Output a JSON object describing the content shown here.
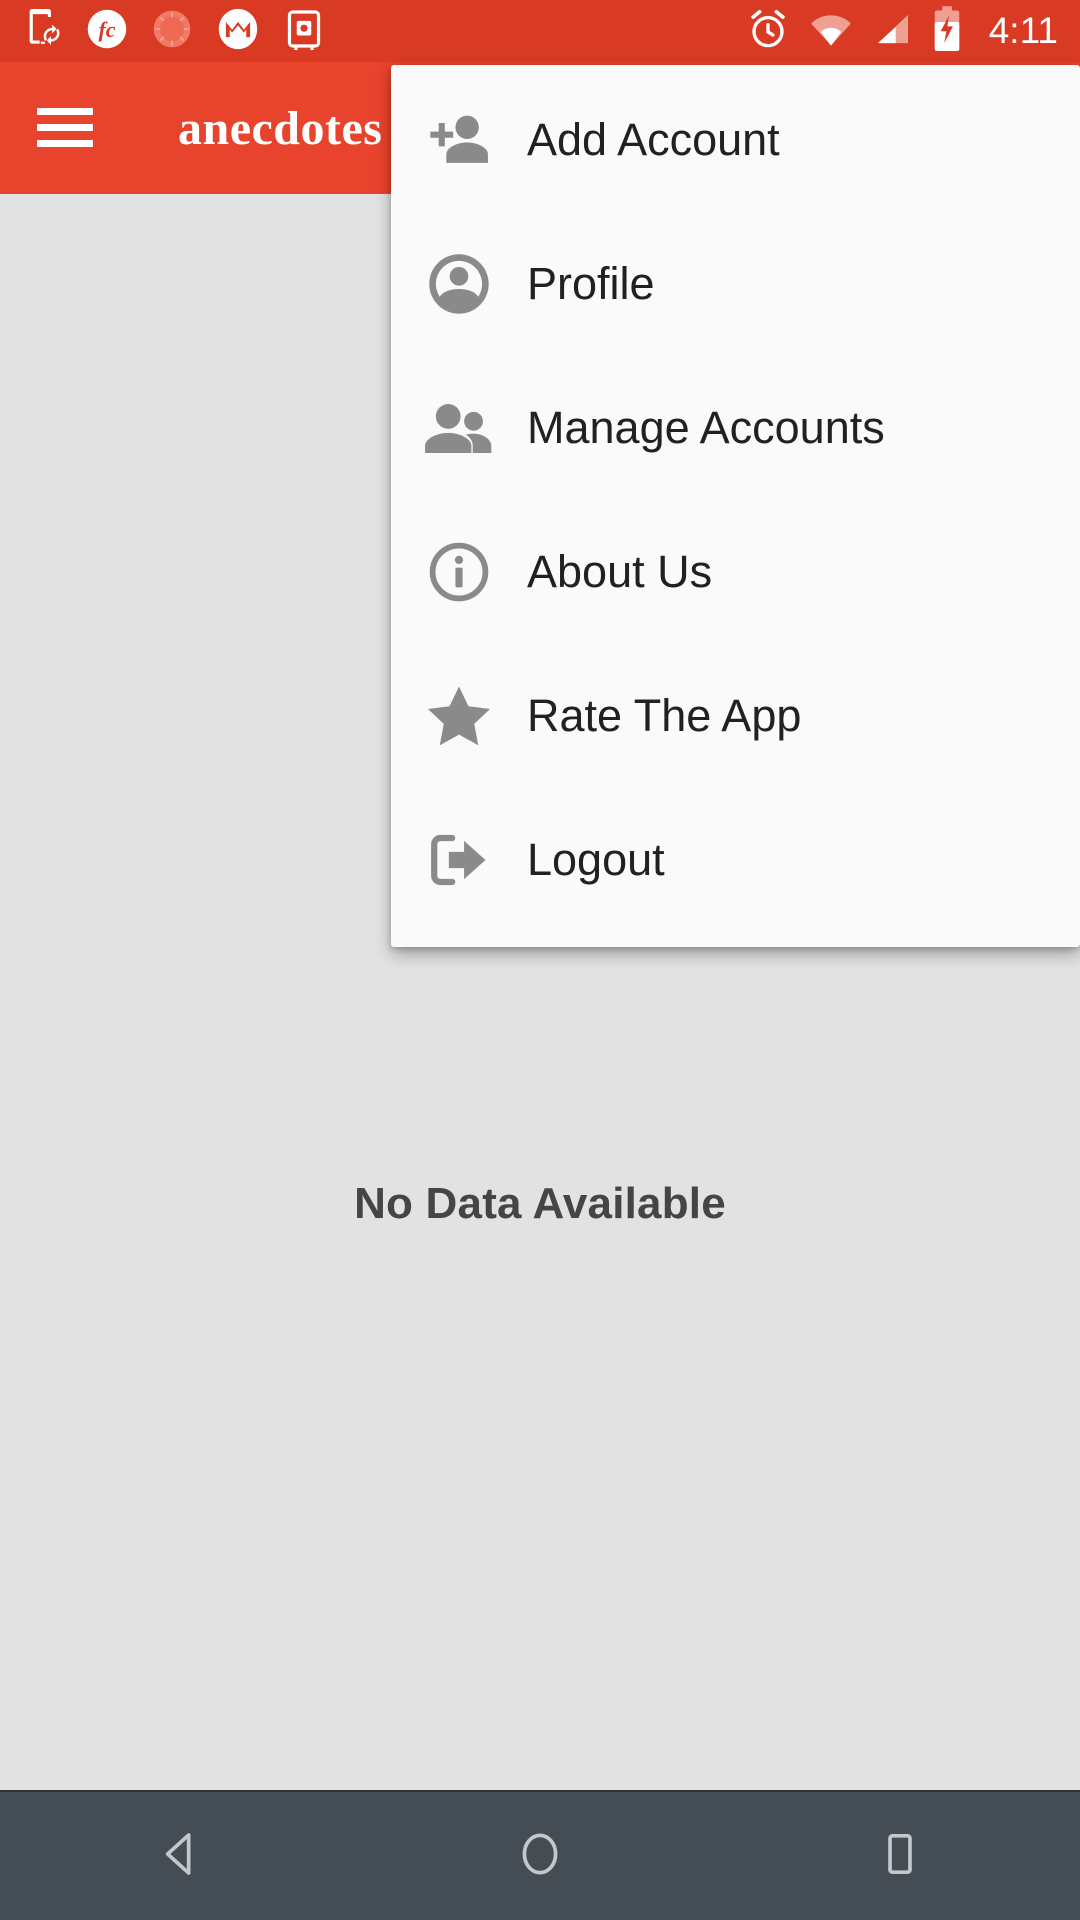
{
  "status_bar": {
    "background_color": "#d93a24",
    "time": "4:11",
    "left_icons": [
      {
        "name": "phone-sync-icon",
        "label": "Phone sync"
      },
      {
        "name": "fc-badge-icon",
        "label": "fc"
      },
      {
        "name": "sunburst-circle-icon",
        "label": "Sunburst"
      },
      {
        "name": "motorola-logo-icon",
        "label": "Motorola"
      },
      {
        "name": "safe-box-icon",
        "label": "Secure storage"
      }
    ],
    "right_icons": [
      {
        "name": "alarm-clock-icon",
        "label": "Alarm set"
      },
      {
        "name": "wifi-icon",
        "label": "Wi-Fi"
      },
      {
        "name": "cellular-signal-icon",
        "label": "Cellular signal"
      },
      {
        "name": "battery-charging-icon",
        "label": "Battery charging"
      }
    ]
  },
  "app_bar": {
    "background_color": "#e8432c",
    "title": "anecdotes",
    "menu_button_label": "Open navigation drawer"
  },
  "content": {
    "background_color": "#e2e2e2",
    "empty_state_text": "No Data Available"
  },
  "overflow_menu": {
    "background_color": "#fafafa",
    "items": [
      {
        "label": "Add Account",
        "icon": "person-add-icon"
      },
      {
        "label": "Profile",
        "icon": "account-circle-icon"
      },
      {
        "label": "Manage Accounts",
        "icon": "people-icon"
      },
      {
        "label": "About Us",
        "icon": "info-outline-icon"
      },
      {
        "label": "Rate The App",
        "icon": "star-icon"
      },
      {
        "label": "Logout",
        "icon": "exit-to-app-icon"
      }
    ]
  },
  "nav_bar": {
    "background_color": "#454d54",
    "buttons": [
      {
        "name": "back-button",
        "label": "Back"
      },
      {
        "name": "home-button",
        "label": "Home"
      },
      {
        "name": "recents-button",
        "label": "Recent apps"
      }
    ]
  }
}
